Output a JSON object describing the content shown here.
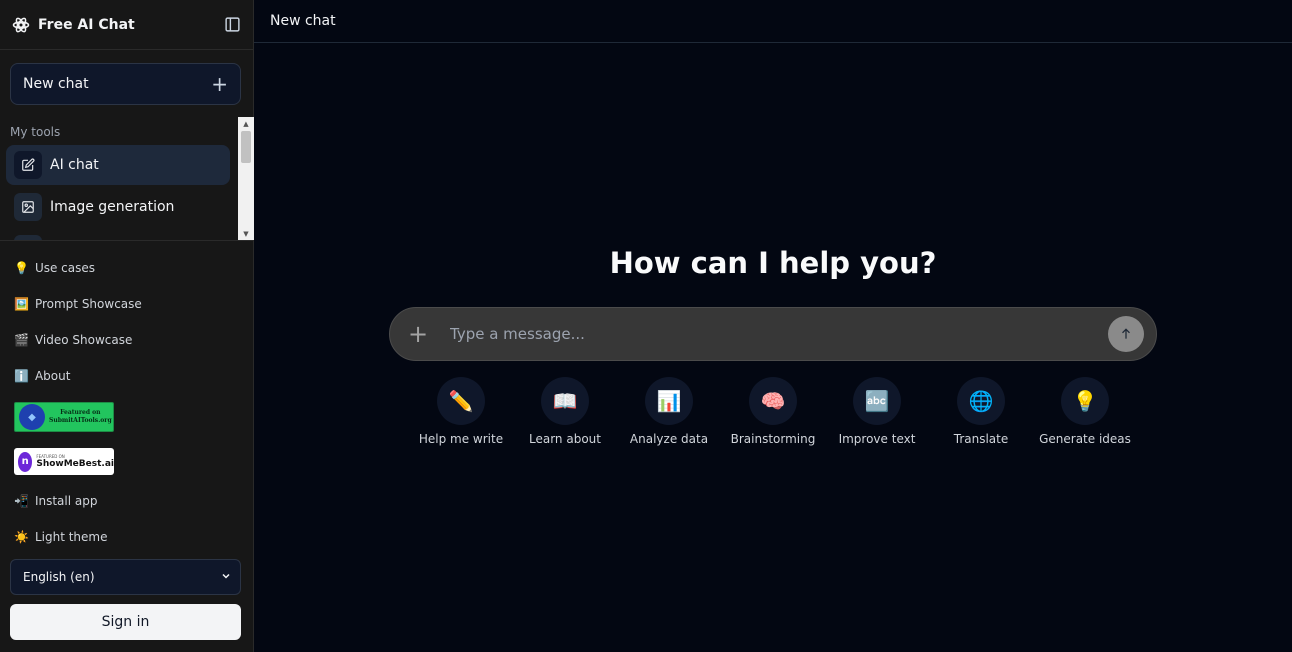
{
  "app": {
    "title": "Free AI Chat"
  },
  "sidebar": {
    "new_chat_label": "New chat",
    "tools_heading": "My tools",
    "tools": [
      {
        "label": "AI chat",
        "icon": "edit-icon",
        "active": true
      },
      {
        "label": "Image generation",
        "icon": "image-icon",
        "active": false
      }
    ],
    "links": [
      {
        "emoji": "💡",
        "label": "Use cases"
      },
      {
        "emoji": "🖼️",
        "label": "Prompt Showcase"
      },
      {
        "emoji": "🎬",
        "label": "Video Showcase"
      },
      {
        "emoji": "ℹ️",
        "label": "About"
      }
    ],
    "badges": {
      "submit": {
        "line1": "Featured on",
        "line2": "SubmitAITools.org"
      },
      "showmebest": {
        "small": "FEATURED ON",
        "big": "ShowMeBest.ai"
      }
    },
    "extra_links": [
      {
        "emoji": "📲",
        "label": "Install app"
      },
      {
        "emoji": "☀️",
        "label": "Light theme"
      }
    ],
    "language": "English (en)",
    "sign_in_label": "Sign in"
  },
  "main": {
    "header_title": "New chat",
    "hero_text": "How can I help you?",
    "composer": {
      "placeholder": "Type a message..."
    },
    "suggestions": [
      {
        "emoji": "✏️",
        "label": "Help me write"
      },
      {
        "emoji": "📖",
        "label": "Learn about"
      },
      {
        "emoji": "📊",
        "label": "Analyze data"
      },
      {
        "emoji": "🧠",
        "label": "Brainstorming"
      },
      {
        "emoji": "🔤",
        "label": "Improve text"
      },
      {
        "emoji": "🌐",
        "label": "Translate"
      },
      {
        "emoji": "💡",
        "label": "Generate ideas"
      }
    ]
  },
  "colors": {
    "background": "#030712",
    "sidebar": "#171717",
    "composer": "#373737",
    "accent_active": "#1e293b"
  }
}
